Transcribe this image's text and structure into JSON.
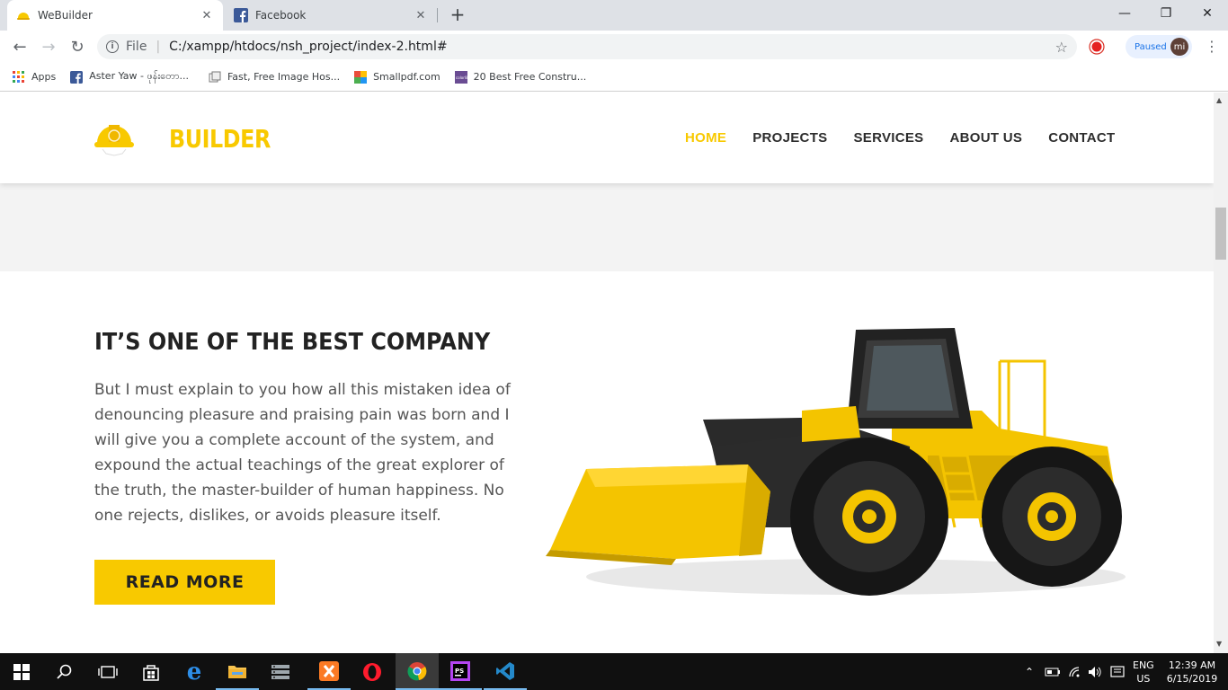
{
  "browser": {
    "tabs": [
      {
        "title": "WeBuilder",
        "active": true
      },
      {
        "title": "Facebook",
        "active": false
      }
    ],
    "new_tab_label": "+",
    "address": {
      "scheme_label": "File",
      "url": "C:/xampp/htdocs/nsh_project/index-2.html#"
    },
    "profile": {
      "status": "Paused",
      "initials": "mi"
    },
    "bookmarks": [
      {
        "label": "Apps",
        "icon": "apps-grid-icon"
      },
      {
        "label": "Aster Yaw - ဖုန်းတော...",
        "icon": "facebook-icon"
      },
      {
        "label": "Fast, Free Image Hos...",
        "icon": "image-host-icon"
      },
      {
        "label": "Smallpdf.com",
        "icon": "smallpdf-icon"
      },
      {
        "label": "20 Best Free Constru...",
        "icon": "colorlib-icon"
      }
    ]
  },
  "site": {
    "brand": "BUILDER",
    "nav": [
      {
        "label": "HOME",
        "active": true
      },
      {
        "label": "PROJECTS",
        "active": false
      },
      {
        "label": "SERVICES",
        "active": false
      },
      {
        "label": "ABOUT US",
        "active": false
      },
      {
        "label": "CONTACT",
        "active": false
      }
    ],
    "about": {
      "title": "IT’S ONE OF THE BEST COMPANY",
      "body": "But I must explain to you how all this mistaken idea of denouncing pleasure and praising pain was born and I will give you a complete account of the system, and expound the actual teachings of the great explorer of the truth, the master-builder of human happiness. No one rejects, dislikes, or avoids pleasure itself.",
      "button": "READ MORE"
    },
    "colors": {
      "accent": "#f8c900",
      "text": "#222222"
    }
  },
  "taskbar": {
    "apps": [
      "start",
      "search",
      "task-view",
      "store",
      "edge",
      "file-explorer",
      "server",
      "xampp",
      "opera",
      "chrome",
      "phpstorm",
      "vscode"
    ],
    "tray": {
      "lang_top": "ENG",
      "lang_bottom": "US",
      "time": "12:39 AM",
      "date": "6/15/2019"
    }
  }
}
